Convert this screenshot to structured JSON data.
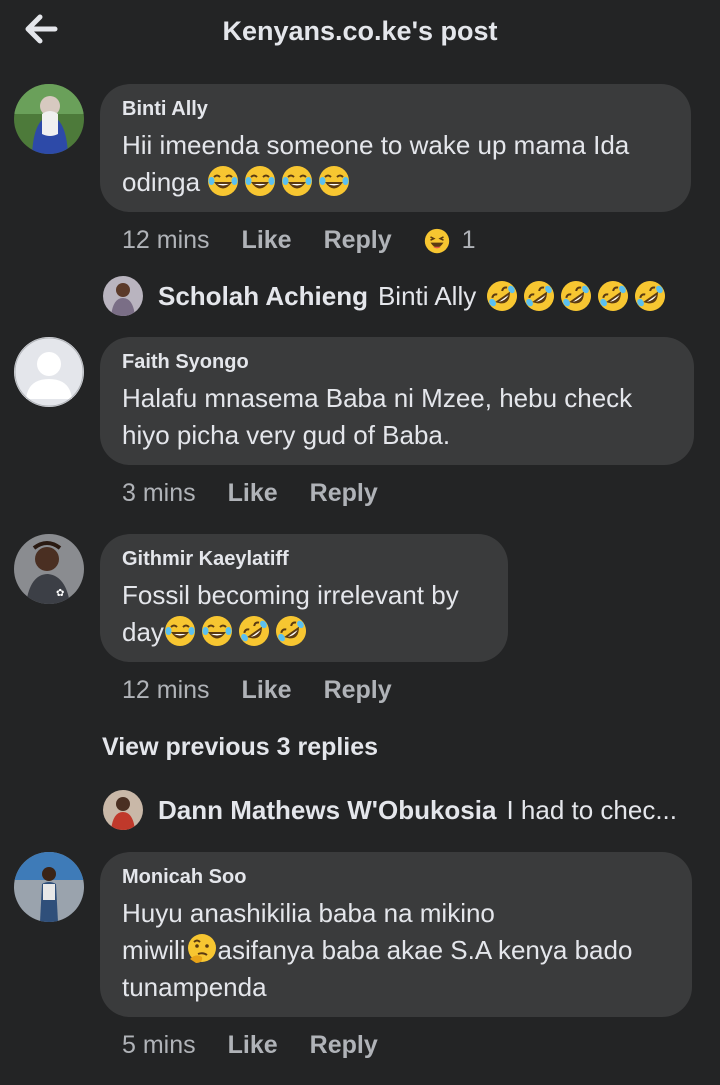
{
  "header": {
    "title": "Kenyans.co.ke's post",
    "back_icon": "arrow-left-icon"
  },
  "comments": [
    {
      "author": "Binti Ally",
      "text": "Hii imeenda someone to wake up mama Ida odinga",
      "emojis": [
        "face-with-tears-of-joy-icon",
        "face-with-tears-of-joy-icon",
        "face-with-tears-of-joy-icon",
        "face-with-tears-of-joy-icon"
      ],
      "time": "12 mins",
      "like": "Like",
      "reply": "Reply",
      "reaction": {
        "icon": "haha-reaction-icon",
        "count": "1"
      },
      "replies": [
        {
          "author": "Scholah Achieng",
          "text": "Binti Ally",
          "emojis": [
            "rolling-on-floor-laughing-icon",
            "rolling-on-floor-laughing-icon",
            "rolling-on-floor-laughing-icon",
            "rolling-on-floor-laughing-icon",
            "rolling-on-floor-laughing-icon"
          ]
        }
      ]
    },
    {
      "author": "Faith Syongo",
      "text": "Halafu mnasema  Baba ni Mzee, hebu check hiyo picha very gud of Baba.",
      "time": "3 mins",
      "like": "Like",
      "reply": "Reply"
    },
    {
      "author": "Githmir Kaeylatiff",
      "text": "Fossil becoming irrelevant by day",
      "emojis": [
        "face-with-tears-of-joy-icon",
        "face-with-tears-of-joy-icon",
        "rolling-on-floor-laughing-icon",
        "rolling-on-floor-laughing-icon"
      ],
      "time": "12 mins",
      "like": "Like",
      "reply": "Reply",
      "view_previous": "View previous 3 replies",
      "replies": [
        {
          "author": "Dann Mathews W'Obukosia",
          "text": "I had to chec..."
        }
      ]
    },
    {
      "author": "Monicah Soo",
      "text_line1": "Huyu anashikilia baba na mikino",
      "text_line2a": "miwili",
      "text_line2b": "asifanya baba akae S.A kenya bado",
      "text_line3": "tunampenda",
      "emojis": [
        "thinking-face-icon"
      ],
      "time": "5 mins",
      "like": "Like",
      "reply": "Reply"
    }
  ],
  "colors": {
    "background": "#232425",
    "bubble": "#3a3b3c",
    "text": "#e4e6eb",
    "secondary": "#b0b3b8"
  }
}
